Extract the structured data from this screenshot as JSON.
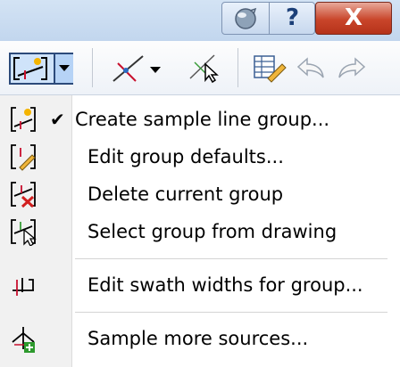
{
  "title_bar": {
    "help_label": "?",
    "close_label": "X"
  },
  "toolbar": {
    "sample_line_tools": "sample-lines-icon",
    "alignment_tool": "alignment-icon",
    "select_tool": "select-alignment-icon",
    "properties_tool": "properties-icon",
    "undo": "undo-icon",
    "redo": "redo-icon"
  },
  "menu": {
    "items": [
      {
        "label": "Create sample line group...",
        "checked": true,
        "icon": "create-group-icon"
      },
      {
        "label": "Edit group defaults...",
        "checked": false,
        "icon": "edit-group-defaults-icon"
      },
      {
        "label": "Delete current group",
        "checked": false,
        "icon": "delete-group-icon"
      },
      {
        "label": "Select group from drawing",
        "checked": false,
        "icon": "select-group-icon"
      },
      {
        "label": "Edit swath widths for group...",
        "checked": false,
        "icon": "swath-widths-icon"
      },
      {
        "label": "Sample more sources...",
        "checked": false,
        "icon": "sample-sources-icon"
      }
    ],
    "check_glyph": "✔"
  },
  "colors": {
    "titlebar": "#c8daf0",
    "close_button": "#c9452a",
    "menu_gutter": "#f1f1f1"
  }
}
